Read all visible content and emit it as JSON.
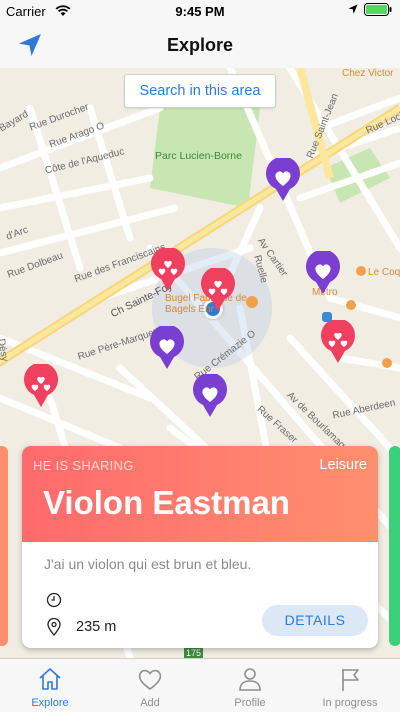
{
  "status_bar": {
    "carrier": "Carrier",
    "time": "9:45 PM"
  },
  "nav": {
    "title": "Explore"
  },
  "map": {
    "search_area_label": "Search in this area",
    "labels": {
      "parc": "Parc Lucien-Borne",
      "rue_saint_jean": "Rue Saint-Jean",
      "ch_sainte_foy": "Ch Sainte-Foy",
      "rue_des_franciscains": "Rue des Franciscains",
      "cote_aqueduc": "Côte de l'Aqueduc",
      "rue_durocher": "Rue Durocher",
      "rue_arago": "Rue Arago O",
      "rue_lockwell": "Rue Lockwell",
      "av_cartier": "Av Cartier",
      "ruelle": "Ruelle",
      "rue_cremazie": "Rue Crémazie O",
      "rue_pere_marquette": "Rue Père-Marquette",
      "rue_fraser": "Rue Fraser",
      "av_bourlamaque": "Av de Bourlamaque",
      "rue_aberdeen": "Rue Aberdeen",
      "rue_dolbeau": "Rue Dolbeau",
      "bayard": "Bayard",
      "chez_victor": "Chez Victor",
      "le_coq": "Le Coq",
      "metro": "Metro",
      "bugel": "Bugel Fabrique de Bagels Enr",
      "desy": "Désy",
      "darc": "d'Arc",
      "route_175": "175"
    }
  },
  "card": {
    "sharing_label": "HE IS SHARING",
    "category": "Leisure",
    "name": "Violon Eastman",
    "description": "J'ai un violon qui est brun et bleu.",
    "time": "",
    "distance": "235 m",
    "details_label": "DETAILS"
  },
  "tabs": [
    {
      "label": "Explore",
      "icon": "home-icon",
      "active": true
    },
    {
      "label": "Add",
      "icon": "heart-icon",
      "active": false
    },
    {
      "label": "Profile",
      "icon": "person-icon",
      "active": false
    },
    {
      "label": "In progress",
      "icon": "flag-icon",
      "active": false
    }
  ],
  "colors": {
    "accent": "#2f7ad6",
    "card_gradient_start": "#ff6a6d",
    "card_gradient_end": "#ff8f6e",
    "pin_red": "#f0405f",
    "pin_purple": "#7a3fd1",
    "park": "#c8e6b2",
    "road_major": "#f6d77a"
  }
}
